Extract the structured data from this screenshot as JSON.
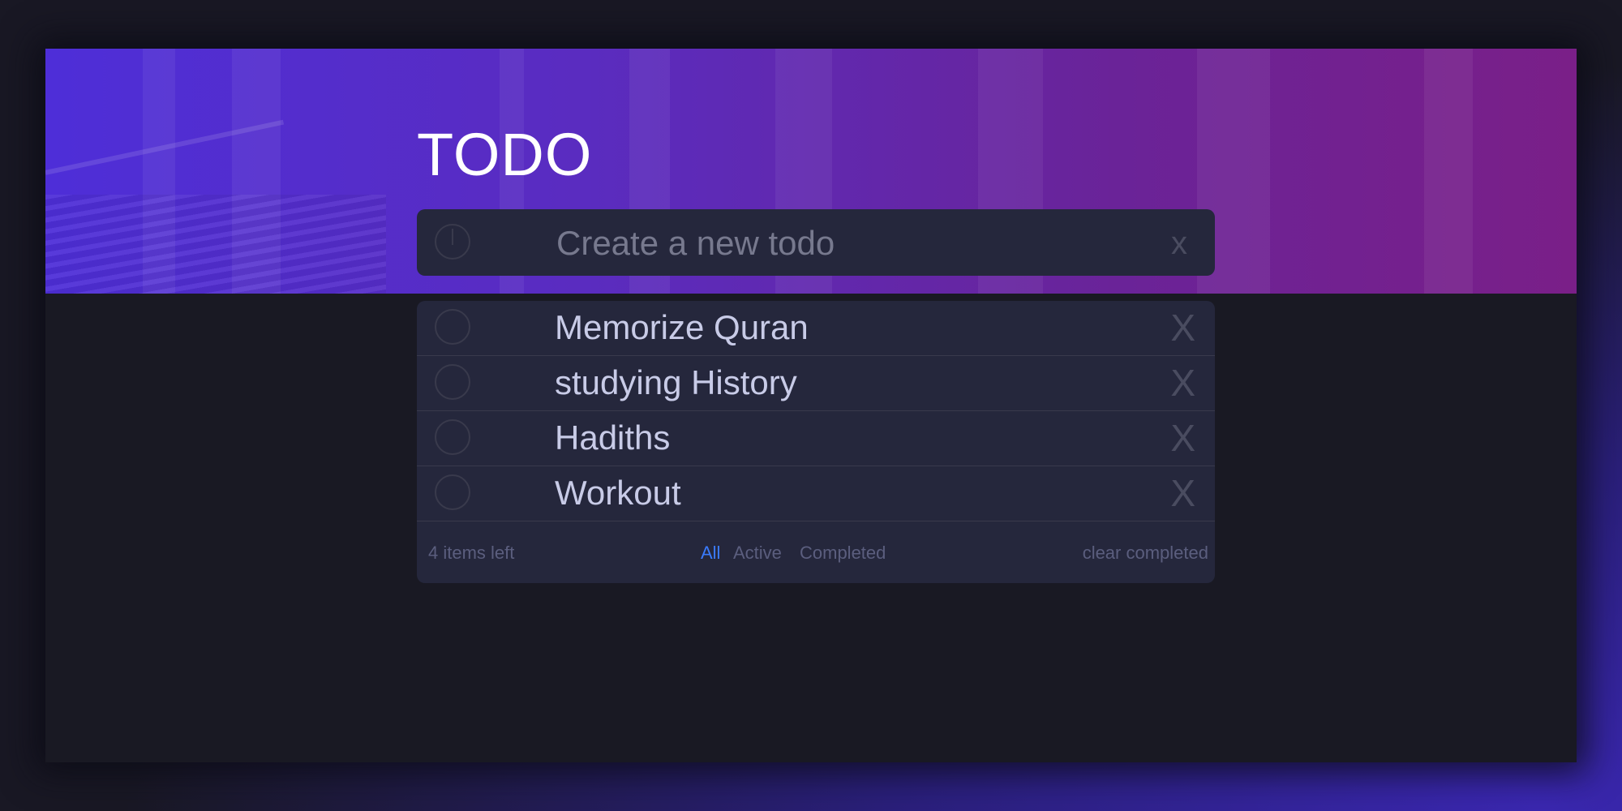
{
  "header": {
    "title": "TODO"
  },
  "new_todo": {
    "placeholder": "Create a new todo",
    "clear_label": "x"
  },
  "todos": [
    {
      "text": "Memorize Quran",
      "delete_label": "X",
      "completed": false
    },
    {
      "text": "studying History",
      "delete_label": "X",
      "completed": false
    },
    {
      "text": "Hadiths",
      "delete_label": "X",
      "completed": false
    },
    {
      "text": "Workout",
      "delete_label": "X",
      "completed": false
    }
  ],
  "footer": {
    "items_left": "4 items left",
    "filters": [
      "All",
      "Active",
      "Completed"
    ],
    "active_filter": "All",
    "clear_completed": "clear completed"
  },
  "colors": {
    "accent": "#3a7bfd",
    "card_bg": "#25273c",
    "page_bg": "#191923",
    "hero_start": "#4e2ed8",
    "hero_end": "#7a1f88"
  }
}
